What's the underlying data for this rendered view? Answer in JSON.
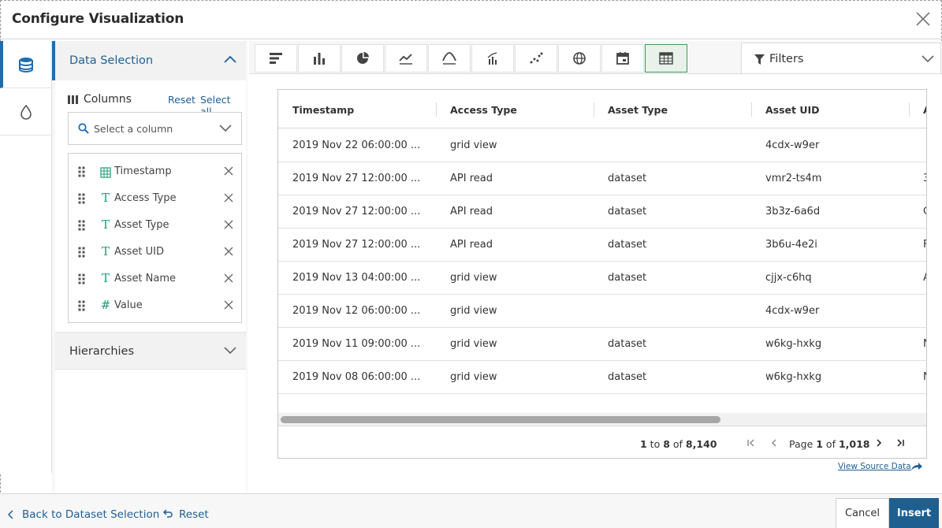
{
  "dialog": {
    "title": "Configure Visualization"
  },
  "rail": {
    "items": [
      {
        "icon": "database-icon",
        "active": true
      },
      {
        "icon": "droplet-icon",
        "active": false
      }
    ]
  },
  "data_selection": {
    "label": "Data Selection",
    "columns_label": "Columns",
    "reset_label": "Reset",
    "select_all_label": "Select all",
    "select_placeholder": "Select a column",
    "columns": [
      {
        "name": "Timestamp",
        "type": "calendar"
      },
      {
        "name": "Access Type",
        "type": "text"
      },
      {
        "name": "Asset Type",
        "type": "text"
      },
      {
        "name": "Asset UID",
        "type": "text"
      },
      {
        "name": "Asset Name",
        "type": "text"
      },
      {
        "name": "Value",
        "type": "number"
      }
    ],
    "type_glyphs": {
      "text": "T",
      "number": "#"
    }
  },
  "hierarchies": {
    "label": "Hierarchies"
  },
  "toolbar": {
    "chart_types": [
      "bar-horizontal",
      "bar-vertical",
      "pie",
      "line",
      "area",
      "combo",
      "scatter",
      "map",
      "calendar",
      "table"
    ],
    "active_chart": "table",
    "filters_label": "Filters"
  },
  "table": {
    "headers": [
      "Timestamp",
      "Access Type",
      "Asset Type",
      "Asset UID",
      "A"
    ],
    "rows": [
      [
        "2019 Nov 22 06:00:00 ...",
        "grid view",
        "",
        "4cdx-w9er",
        ""
      ],
      [
        "2019 Nov 27 12:00:00 ...",
        "API read",
        "dataset",
        "vmr2-ts4m",
        "3"
      ],
      [
        "2019 Nov 27 12:00:00 ...",
        "API read",
        "dataset",
        "3b3z-6a6d",
        "C"
      ],
      [
        "2019 Nov 27 12:00:00 ...",
        "API read",
        "dataset",
        "3b6u-4e2i",
        "F"
      ],
      [
        "2019 Nov 13 04:00:00 ...",
        "grid view",
        "dataset",
        "cjjx-c6hq",
        "A"
      ],
      [
        "2019 Nov 12 06:00:00 ...",
        "grid view",
        "",
        "4cdx-w9er",
        ""
      ],
      [
        "2019 Nov 11 09:00:00 ...",
        "grid view",
        "dataset",
        "w6kg-hxkg",
        "N"
      ],
      [
        "2019 Nov 08 06:00:00 ...",
        "grid view",
        "dataset",
        "w6kg-hxkg",
        "N"
      ]
    ],
    "pager": {
      "range_start": "1",
      "range_to": " to ",
      "range_end": "8",
      "of": " of ",
      "total": "8,140",
      "page_label": "Page ",
      "page": "1",
      "page_of": " of ",
      "pages": "1,018"
    }
  },
  "view_source_label": "View Source Data",
  "footer": {
    "back_label": "Back to Dataset Selection",
    "reset_label": "Reset",
    "cancel_label": "Cancel",
    "insert_label": "Insert"
  },
  "colors": {
    "accent": "#1f6db1",
    "active_chart_border": "#3f9a5a",
    "type_icon": "#1f9e79",
    "insert_bg": "#1f5f8f"
  }
}
